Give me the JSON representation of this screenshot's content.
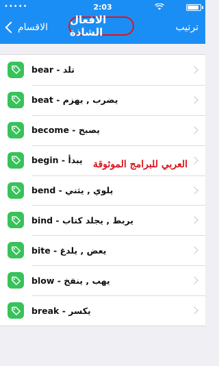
{
  "status_bar": {
    "carrier": "•••••",
    "time": "2:03",
    "battery_level": 0.9
  },
  "nav": {
    "back_label": "الاقسام",
    "title": "الافعال الشاذة",
    "right_label": "ترتيب"
  },
  "items": [
    {
      "label": "bear - تلد"
    },
    {
      "label": "beat - يضرب , يهزم"
    },
    {
      "label": "become - يصبح"
    },
    {
      "label": "begin - يبدأ"
    },
    {
      "label": "bend - يلوي , يثني"
    },
    {
      "label": "bind - يربط , يجلد كتاب"
    },
    {
      "label": "bite - يعض , يلدغ"
    },
    {
      "label": "blow - يهب , ينفخ"
    },
    {
      "label": "break - يكسر"
    }
  ],
  "watermark": "العربي للبرامج الموثوقة",
  "colors": {
    "nav": "#1b8ef5",
    "icon": "#37c25a",
    "highlight": "#e0151b"
  }
}
